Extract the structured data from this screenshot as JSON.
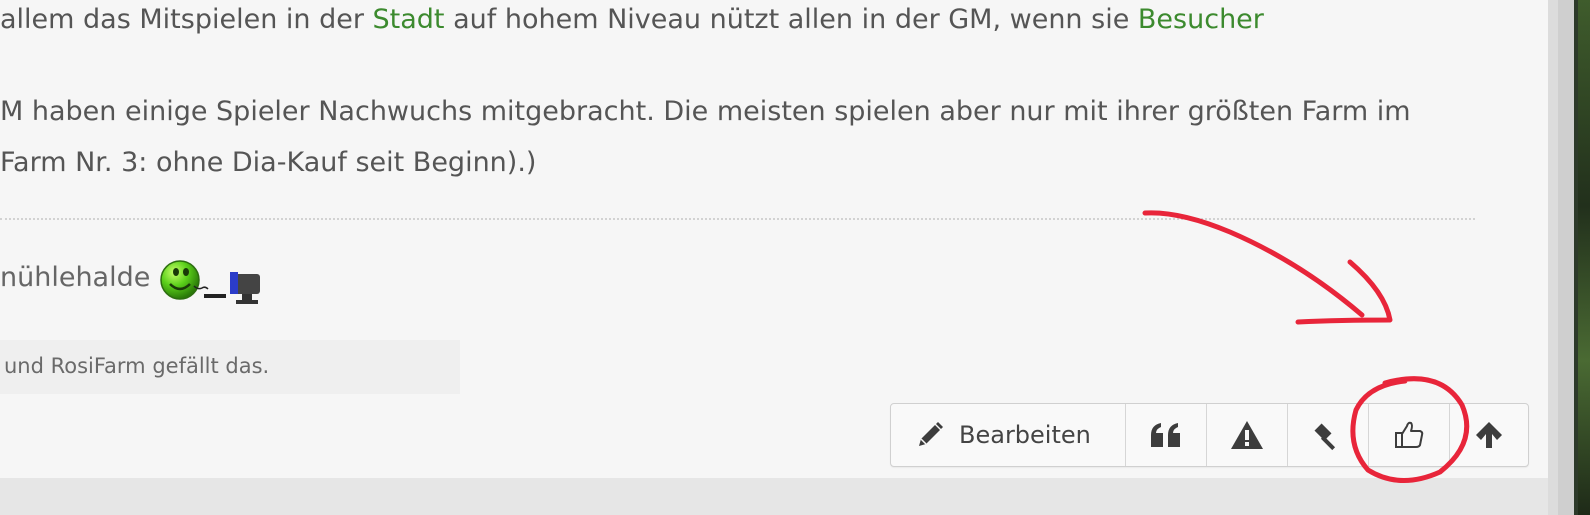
{
  "post": {
    "line1": {
      "seg1": "allem das Mitspielen in der ",
      "link1": "Stadt",
      "seg2": " auf hohem Niveau nützt allen in der GM, wenn sie ",
      "link2": "Besucher"
    },
    "line2": "M haben einige Spieler Nachwuchs mitgebracht. Die meisten spielen aber nur mit ihrer größten Farm im",
    "line3": " Farm Nr. 3: ohne Dia-Kauf seit Beginn).)",
    "signature": "nühlehalde",
    "likes_text": "und RosiFarm gefällt das."
  },
  "toolbar": {
    "edit_label": "Bearbeiten",
    "buttons": [
      "pencil-icon",
      "quote-icon",
      "report-warning-icon",
      "moderate-gavel-icon",
      "like-thumbs-up-icon",
      "scroll-top-arrow-icon"
    ]
  },
  "colors": {
    "link": "#3c8a2e",
    "text": "#555555",
    "annotation": "#e8253a"
  }
}
